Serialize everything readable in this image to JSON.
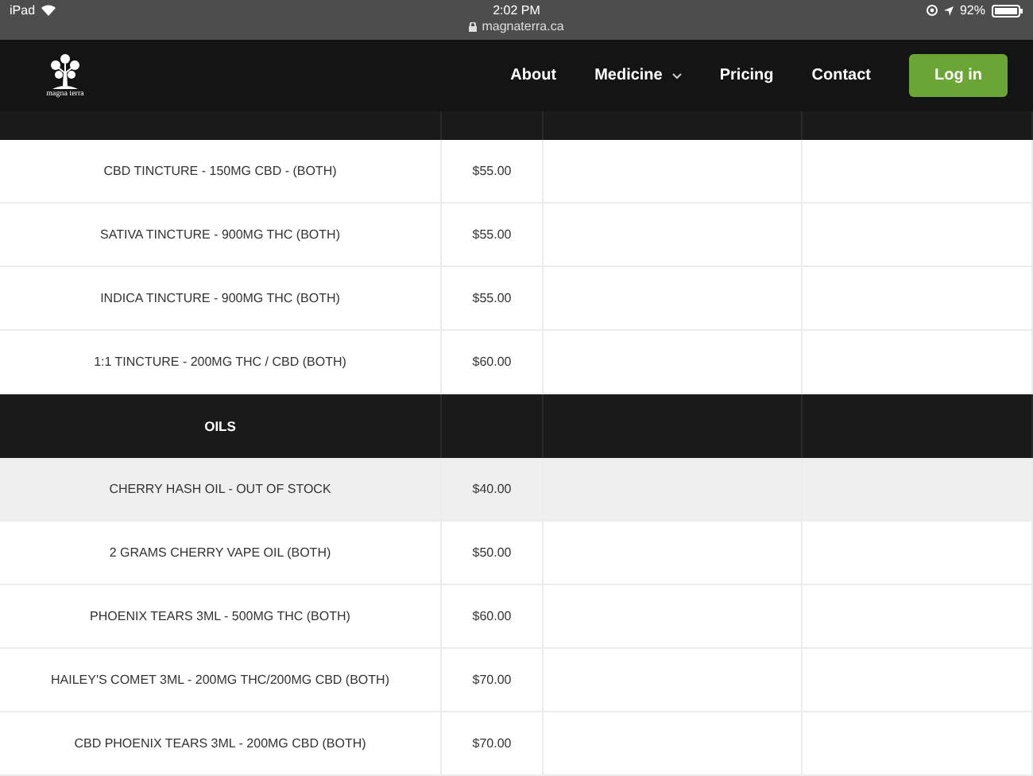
{
  "status_bar": {
    "device": "iPad",
    "time": "2:02 PM",
    "address": "magnaterra.ca",
    "battery": "92%"
  },
  "nav": {
    "logo_text": "magna terra",
    "links": [
      {
        "label": "About",
        "dropdown": false
      },
      {
        "label": "Medicine",
        "dropdown": true
      },
      {
        "label": "Pricing",
        "dropdown": false
      },
      {
        "label": "Contact",
        "dropdown": false
      }
    ],
    "login": "Log in"
  },
  "sections": [
    {
      "rows": [
        {
          "name": "CBD TINCTURE - 150MG CBD - (BOTH)",
          "price": "$55.00",
          "highlighted": false
        },
        {
          "name": "SATIVA TINCTURE - 900MG THC (BOTH)",
          "price": "$55.00",
          "highlighted": false
        },
        {
          "name": "INDICA TINCTURE - 900MG THC (BOTH)",
          "price": "$55.00",
          "highlighted": false
        },
        {
          "name": "1:1 TINCTURE - 200MG THC / CBD (BOTH)",
          "price": "$60.00",
          "highlighted": false
        }
      ]
    },
    {
      "title": "OILS",
      "rows": [
        {
          "name": "CHERRY HASH OIL - OUT OF STOCK",
          "price": "$40.00",
          "highlighted": true
        },
        {
          "name": "2 GRAMS CHERRY VAPE OIL (BOTH)",
          "price": "$50.00",
          "highlighted": false
        },
        {
          "name": "PHOENIX TEARS 3ML - 500MG THC (BOTH)",
          "price": "$60.00",
          "highlighted": false
        },
        {
          "name": "HAILEY'S COMET 3ML - 200MG THC/200MG CBD (BOTH)",
          "price": "$70.00",
          "highlighted": false
        },
        {
          "name": "CBD PHOENIX TEARS 3ML - 200MG CBD (BOTH)",
          "price": "$70.00",
          "highlighted": false
        }
      ]
    }
  ]
}
